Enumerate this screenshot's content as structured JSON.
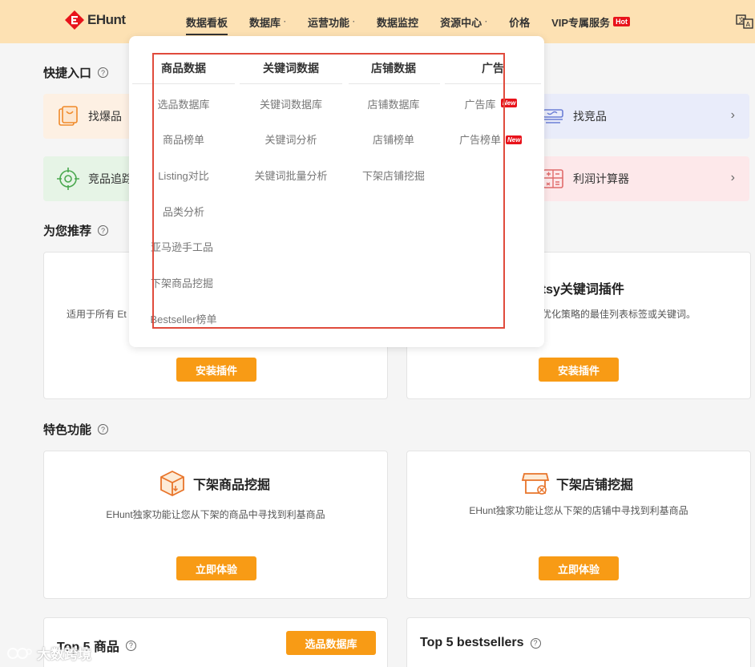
{
  "header": {
    "logo_text": "EHunt",
    "nav": [
      {
        "label": "数据看板",
        "caret": false
      },
      {
        "label": "数据库",
        "caret": true
      },
      {
        "label": "运营功能",
        "caret": true
      },
      {
        "label": "数据监控",
        "caret": false
      },
      {
        "label": "资源中心",
        "caret": true
      },
      {
        "label": "价格",
        "caret": false
      },
      {
        "label": "VIP专属服务",
        "caret": false
      }
    ],
    "hot_badge": "Hot",
    "caret_glyph": "·"
  },
  "quick_entry": {
    "title": "快捷入口",
    "help": "?",
    "cards": [
      {
        "label": "找爆品",
        "icon": "bag-icon"
      },
      {
        "label": "找竞品",
        "icon": "stack-icon",
        "arrow": "›"
      },
      {
        "label": "竞品追踪",
        "icon": "target-icon"
      },
      {
        "label": "利润计算器",
        "icon": "calculator-icon",
        "arrow": "›"
      }
    ]
  },
  "recommend": {
    "title": "为您推荐",
    "help": "?",
    "left_desc": "适用于所有 Et",
    "right_title": "Etsy关键词插件",
    "right_desc": "优化策略的最佳列表标签或关键词。",
    "install_label": "安装插件"
  },
  "features": {
    "title": "特色功能",
    "help": "?",
    "cards": [
      {
        "title": "下架商品挖掘",
        "desc": "EHunt独家功能让您从下架的商品中寻找到利基商品",
        "button": "立即体验"
      },
      {
        "title": "下架店铺挖掘",
        "desc": "EHunt独家功能让您从下架的店铺中寻找到利基商品",
        "button": "立即体验"
      }
    ]
  },
  "top5": {
    "products_title": "Top 5 商品",
    "help": "?",
    "products_button": "选品数据库",
    "bestsellers_title": "Top 5 bestsellers"
  },
  "dropdown": {
    "columns": [
      {
        "head": "商品数据",
        "items": [
          "选品数据库",
          "商品榜单",
          "Listing对比",
          "品类分析",
          "亚马逊手工品",
          "下架商品挖掘",
          "Bestseller榜单"
        ]
      },
      {
        "head": "关键词数据",
        "items": [
          "关键词数据库",
          "关键词分析",
          "关键词批量分析"
        ]
      },
      {
        "head": "店铺数据",
        "items": [
          "店铺数据库",
          "店铺榜单",
          "下架店铺挖掘"
        ]
      },
      {
        "head": "广告",
        "items": [
          "广告库",
          "广告榜单"
        ]
      }
    ],
    "new_badge": "New"
  },
  "watermark": "大数跨境",
  "colors": {
    "header_bg": "#fde1b3",
    "accent": "#f89b15",
    "badge_red": "#e8131b",
    "highlight": "#e04b3c"
  }
}
